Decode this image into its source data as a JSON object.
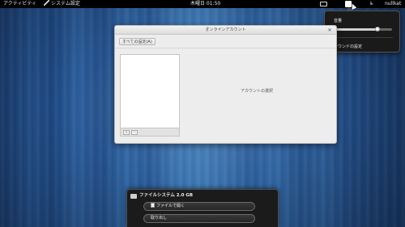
{
  "topbar": {
    "activities": "アクティビティ",
    "app_menu": "システム設定",
    "clock": "木曜日 01:50",
    "user": "nullkat"
  },
  "volume_popup": {
    "label": "音量",
    "level_percent": 75,
    "settings_link": "サウンドの設定"
  },
  "window": {
    "title": "オンラインアカウント",
    "all_settings_button": "すべての設定(A)",
    "placeholder": "アカウントの選択"
  },
  "notification": {
    "title": "ファイルシステム 2.0 GB",
    "open_button": "ファイルで開く",
    "eject_button": "取り出し"
  }
}
